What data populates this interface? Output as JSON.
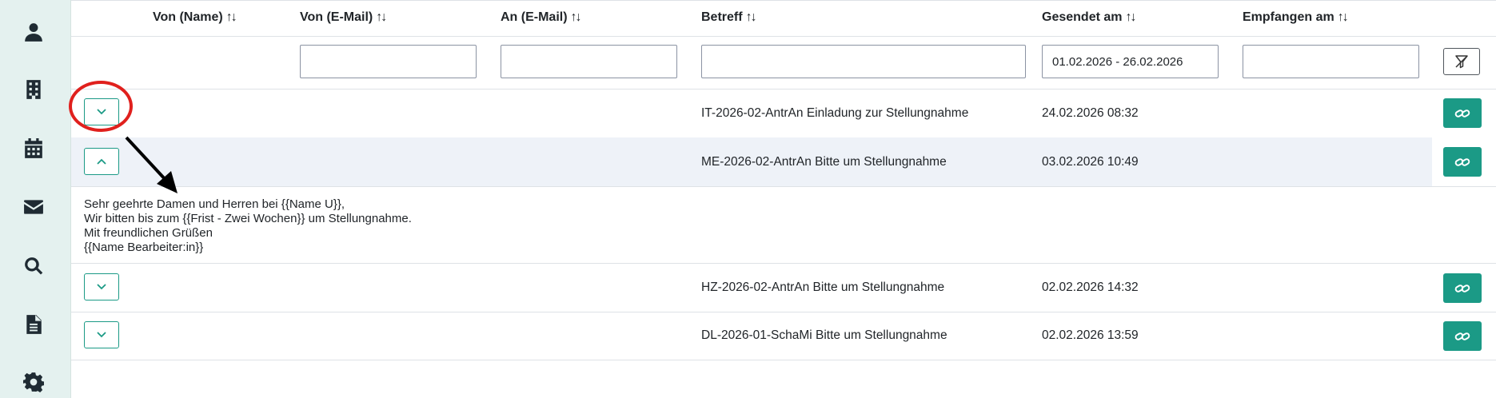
{
  "sidebar": {
    "items": [
      {
        "icon": "user-icon"
      },
      {
        "icon": "building-icon"
      },
      {
        "icon": "calendar-icon"
      },
      {
        "icon": "envelope-icon"
      },
      {
        "icon": "search-icon"
      },
      {
        "icon": "document-icon"
      },
      {
        "icon": "gear-icon"
      }
    ]
  },
  "table": {
    "headers": {
      "from_name": "Von (Name)",
      "from_email": "Von (E-Mail)",
      "to_email": "An (E-Mail)",
      "subject": "Betreff",
      "sent_at": "Gesendet am",
      "received_at": "Empfangen am"
    },
    "sort_icon": "↑↓",
    "filters": {
      "from_email": "",
      "to_email": "",
      "subject": "",
      "sent_range": "01.02.2026 - 26.02.2026",
      "received": ""
    },
    "rows": [
      {
        "subject": "IT-2026-02-AntrAn Einladung zur Stellungnahme",
        "sent": "24.02.2026 08:32",
        "expanded": false
      },
      {
        "subject": "ME-2026-02-AntrAn Bitte um Stellungnahme",
        "sent": "03.02.2026 10:49",
        "expanded": true
      },
      {
        "subject": "HZ-2026-02-AntrAn Bitte um Stellungnahme",
        "sent": "02.02.2026 14:32",
        "expanded": false
      },
      {
        "subject": "DL-2026-01-SchaMi Bitte um Stellungnahme",
        "sent": "02.02.2026 13:59",
        "expanded": false
      }
    ],
    "expanded_body": {
      "line1": "Sehr geehrte Damen und Herren bei {{Name U}},",
      "line2": "Wir bitten bis zum {{Frist - Zwei Wochen}} um Stellungnahme.",
      "line3": "Mit freundlichen Grüßen",
      "line4": "{{Name Bearbeiter:in}}"
    }
  },
  "colors": {
    "accent": "#1b9a86",
    "sidebar_bg": "#e4f1ef",
    "annotation": "#e0201d"
  }
}
